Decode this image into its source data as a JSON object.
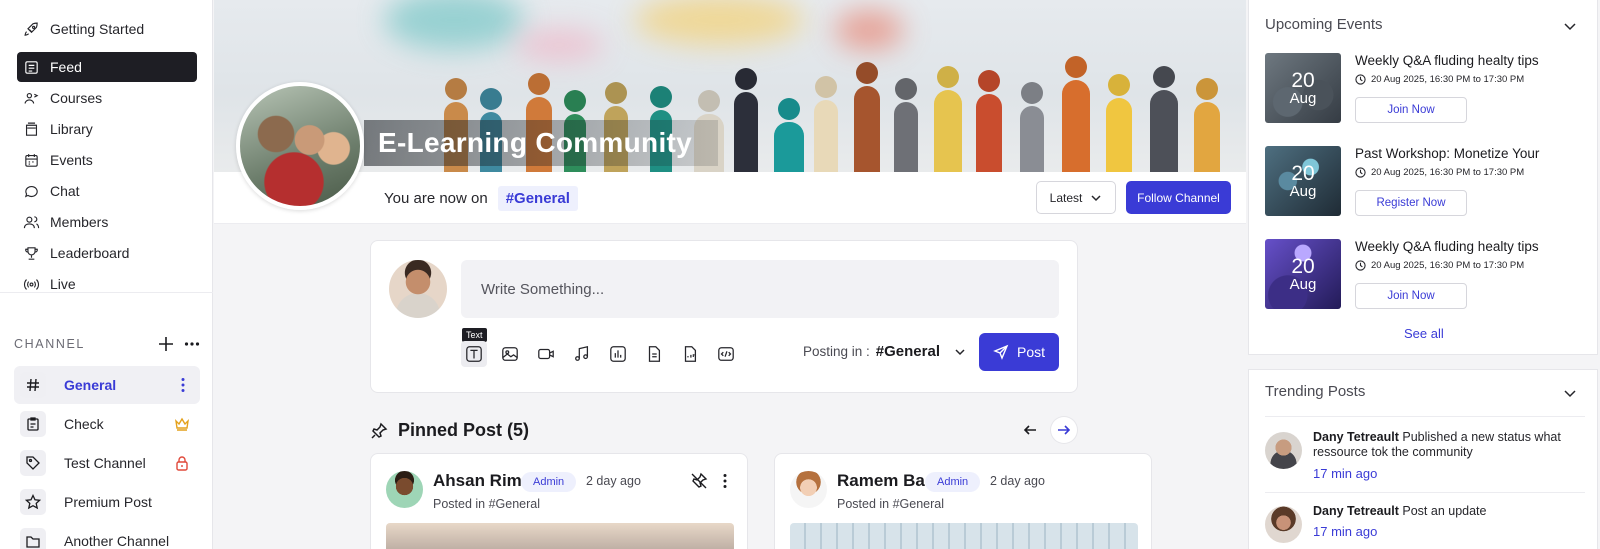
{
  "sidebar": {
    "nav": [
      {
        "label": "Getting Started",
        "icon": "rocket-icon"
      },
      {
        "label": "Feed",
        "icon": "feed-icon",
        "active": true
      },
      {
        "label": "Courses",
        "icon": "courses-icon"
      },
      {
        "label": "Library",
        "icon": "library-icon"
      },
      {
        "label": "Events",
        "icon": "calendar-icon"
      },
      {
        "label": "Chat",
        "icon": "chat-icon"
      },
      {
        "label": "Members",
        "icon": "members-icon"
      },
      {
        "label": "Leaderboard",
        "icon": "trophy-icon"
      },
      {
        "label": "Live",
        "icon": "live-icon"
      }
    ],
    "channel_header": "CHANNEL",
    "channels": [
      {
        "label": "General",
        "icon": "hash-icon",
        "active": true
      },
      {
        "label": "Check",
        "icon": "clipboard-icon"
      },
      {
        "label": "Test Channel",
        "icon": "tag-icon"
      },
      {
        "label": "Premium Post",
        "icon": "star-icon"
      },
      {
        "label": "Another Channel",
        "icon": "folder-icon"
      }
    ]
  },
  "banner": {
    "title": "E-Learning Community"
  },
  "profile": {
    "now_on_label": "You are now on",
    "channel": "#General"
  },
  "sort": {
    "label": "Latest"
  },
  "follow_button": "Follow Channel",
  "composer": {
    "placeholder": "Write Something...",
    "tooltip": "Text",
    "posting_in_label": "Posting in :",
    "posting_in_channel": "#General",
    "post_button": "Post"
  },
  "pinned": {
    "title": "Pinned Post (5)",
    "posts": [
      {
        "name": "Ahsan Rim",
        "badge": "Admin",
        "time": "2 day ago",
        "posted_in": "Posted in #General"
      },
      {
        "name": "Ramem Ba",
        "badge": "Admin",
        "time": "2 day ago",
        "posted_in": "Posted in #General"
      }
    ]
  },
  "events": {
    "title": "Upcoming Events",
    "items": [
      {
        "day": "20",
        "month": "Aug",
        "title": "Weekly Q&A fluding healty tips",
        "date": "20 Aug 2025, 16:30 PM to 17:30 PM",
        "button": "Join Now"
      },
      {
        "day": "20",
        "month": "Aug",
        "title": "Past Workshop: Monetize Your",
        "date": "20 Aug 2025, 16:30 PM to 17:30 PM",
        "button": "Register Now"
      },
      {
        "day": "20",
        "month": "Aug",
        "title": "Weekly Q&A fluding healty tips",
        "date": "20 Aug 2025, 16:30 PM to 17:30 PM",
        "button": "Join Now"
      }
    ],
    "see_all": "See all"
  },
  "trending": {
    "title": "Trending Posts",
    "items": [
      {
        "author": "Dany Tetreault",
        "text": "Published a new status what ressource tok the community",
        "ago": "17 min ago"
      },
      {
        "author": "Dany Tetreault",
        "text": "Post an update",
        "ago": "17 min ago"
      }
    ]
  },
  "colors": {
    "accent": "#3a3bd6",
    "active_nav": "#1e1e24"
  }
}
